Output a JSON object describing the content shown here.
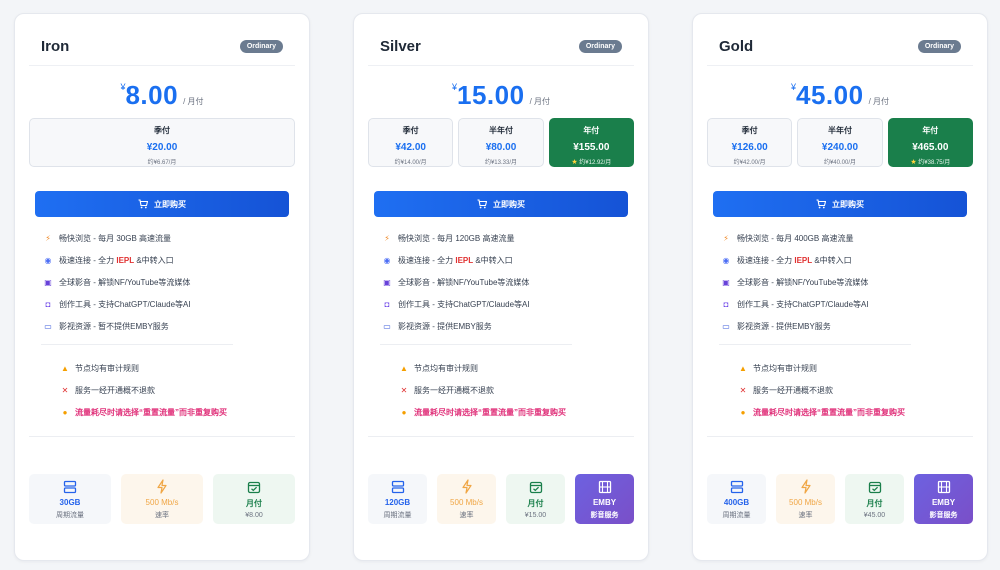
{
  "currency_symbol": "¥",
  "cards": [
    {
      "name": "Iron",
      "badge": "Ordinary",
      "price": "8.00",
      "per": "/ 月付",
      "periods": [
        {
          "label": "季付",
          "price": "¥20.00",
          "monthly": "约¥6.67/月",
          "selected": false
        }
      ],
      "buy_label": "立即购买",
      "features": [
        {
          "icon": "lightning-icon",
          "pre": "畅快浏览 - 每月 30GB 高速流量",
          "hl": "",
          "post": ""
        },
        {
          "icon": "swirl-icon",
          "pre": "极速连接 - 全力 ",
          "hl": "IEPL",
          "post": " &中转入口"
        },
        {
          "icon": "clapper-icon",
          "pre": "全球影音 - 解锁NF/YouTube等流媒体",
          "hl": "",
          "post": ""
        },
        {
          "icon": "robot-icon",
          "pre": "创作工具 - 支持ChatGPT/Claude等AI",
          "hl": "",
          "post": ""
        },
        {
          "icon": "tv-icon",
          "pre": "影视资源 - 暂不提供EMBY服务",
          "hl": "",
          "post": ""
        }
      ],
      "notes": [
        {
          "icon": "warning-icon",
          "text": "节点均有审计规则",
          "alert": false
        },
        {
          "icon": "cross-icon",
          "text": "服务一经开通概不退款",
          "alert": false
        },
        {
          "icon": "bulb-icon",
          "text": "流量耗尽时请选择“重置流量”而非重复购买",
          "alert": true
        }
      ],
      "stats": [
        {
          "kind": "traffic",
          "icon": "server-icon",
          "value": "30GB",
          "sub": "周期流量"
        },
        {
          "kind": "speed",
          "icon": "lightning-icon",
          "value": "500 Mb/s",
          "sub": "速率"
        },
        {
          "kind": "cycle",
          "icon": "calendar-check-icon",
          "value": "月付",
          "sub": "¥8.00"
        }
      ]
    },
    {
      "name": "Silver",
      "badge": "Ordinary",
      "price": "15.00",
      "per": "/ 月付",
      "periods": [
        {
          "label": "季付",
          "price": "¥42.00",
          "monthly": "约¥14.00/月",
          "selected": false
        },
        {
          "label": "半年付",
          "price": "¥80.00",
          "monthly": "约¥13.33/月",
          "selected": false
        },
        {
          "label": "年付",
          "price": "¥155.00",
          "monthly": "约¥12.92/月",
          "selected": true
        }
      ],
      "buy_label": "立即购买",
      "features": [
        {
          "icon": "lightning-icon",
          "pre": "畅快浏览 - 每月 120GB 高速流量",
          "hl": "",
          "post": ""
        },
        {
          "icon": "swirl-icon",
          "pre": "极速连接 - 全力 ",
          "hl": "IEPL",
          "post": " &中转入口"
        },
        {
          "icon": "clapper-icon",
          "pre": "全球影音 - 解锁NF/YouTube等流媒体",
          "hl": "",
          "post": ""
        },
        {
          "icon": "robot-icon",
          "pre": "创作工具 - 支持ChatGPT/Claude等AI",
          "hl": "",
          "post": ""
        },
        {
          "icon": "tv-icon",
          "pre": "影视资源 - 提供EMBY服务",
          "hl": "",
          "post": ""
        }
      ],
      "notes": [
        {
          "icon": "warning-icon",
          "text": "节点均有审计规则",
          "alert": false
        },
        {
          "icon": "cross-icon",
          "text": "服务一经开通概不退款",
          "alert": false
        },
        {
          "icon": "bulb-icon",
          "text": "流量耗尽时请选择“重置流量”而非重复购买",
          "alert": true
        }
      ],
      "stats": [
        {
          "kind": "traffic",
          "icon": "server-icon",
          "value": "120GB",
          "sub": "周期流量"
        },
        {
          "kind": "speed",
          "icon": "lightning-icon",
          "value": "500 Mb/s",
          "sub": "速率"
        },
        {
          "kind": "cycle",
          "icon": "calendar-check-icon",
          "value": "月付",
          "sub": "¥15.00"
        },
        {
          "kind": "emby",
          "icon": "film-icon",
          "value": "EMBY",
          "sub": "影音服务"
        }
      ]
    },
    {
      "name": "Gold",
      "badge": "Ordinary",
      "price": "45.00",
      "per": "/ 月付",
      "periods": [
        {
          "label": "季付",
          "price": "¥126.00",
          "monthly": "约¥42.00/月",
          "selected": false
        },
        {
          "label": "半年付",
          "price": "¥240.00",
          "monthly": "约¥40.00/月",
          "selected": false
        },
        {
          "label": "年付",
          "price": "¥465.00",
          "monthly": "约¥38.75/月",
          "selected": true
        }
      ],
      "buy_label": "立即购买",
      "features": [
        {
          "icon": "lightning-icon",
          "pre": "畅快浏览 - 每月 400GB 高速流量",
          "hl": "",
          "post": ""
        },
        {
          "icon": "swirl-icon",
          "pre": "极速连接 - 全力 ",
          "hl": "IEPL",
          "post": " &中转入口"
        },
        {
          "icon": "clapper-icon",
          "pre": "全球影音 - 解锁NF/YouTube等流媒体",
          "hl": "",
          "post": ""
        },
        {
          "icon": "robot-icon",
          "pre": "创作工具 - 支持ChatGPT/Claude等AI",
          "hl": "",
          "post": ""
        },
        {
          "icon": "tv-icon",
          "pre": "影视资源 - 提供EMBY服务",
          "hl": "",
          "post": ""
        }
      ],
      "notes": [
        {
          "icon": "warning-icon",
          "text": "节点均有审计规则",
          "alert": false
        },
        {
          "icon": "cross-icon",
          "text": "服务一经开通概不退款",
          "alert": false
        },
        {
          "icon": "bulb-icon",
          "text": "流量耗尽时请选择“重置流量”而非重复购买",
          "alert": true
        }
      ],
      "stats": [
        {
          "kind": "traffic",
          "icon": "server-icon",
          "value": "400GB",
          "sub": "周期流量"
        },
        {
          "kind": "speed",
          "icon": "lightning-icon",
          "value": "500 Mb/s",
          "sub": "速率"
        },
        {
          "kind": "cycle",
          "icon": "calendar-check-icon",
          "value": "月付",
          "sub": "¥45.00"
        },
        {
          "kind": "emby",
          "icon": "film-icon",
          "value": "EMBY",
          "sub": "影音服务"
        }
      ]
    }
  ]
}
